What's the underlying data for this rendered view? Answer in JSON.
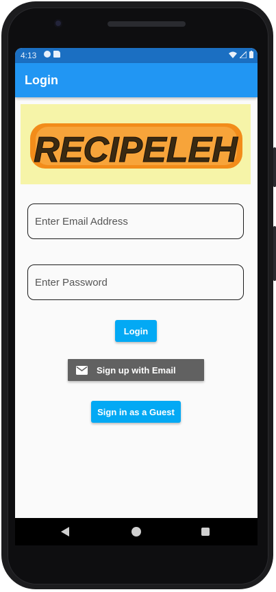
{
  "status_bar": {
    "time": "4:13",
    "left_icons": [
      "app-notification-icon",
      "sd-card-icon"
    ],
    "right_icons": [
      "wifi-icon",
      "signal-icon",
      "battery-icon"
    ]
  },
  "app_bar": {
    "title": "Login",
    "color": "#2196f3"
  },
  "logo": {
    "text": "RECIPELEH",
    "background": "#f6f4a8",
    "text_color": "#3a2a12",
    "outline_color": "#f28c1a"
  },
  "form": {
    "email_placeholder": "Enter Email Address",
    "password_placeholder": "Enter Password"
  },
  "buttons": {
    "login_label": "Login",
    "signup_label": "Sign up with Email",
    "guest_label": "Sign in as a Guest",
    "primary_color": "#03a9f4",
    "signup_color": "#616161"
  },
  "nav_bar": {
    "icons": [
      "back-icon",
      "home-icon",
      "recents-icon"
    ]
  }
}
